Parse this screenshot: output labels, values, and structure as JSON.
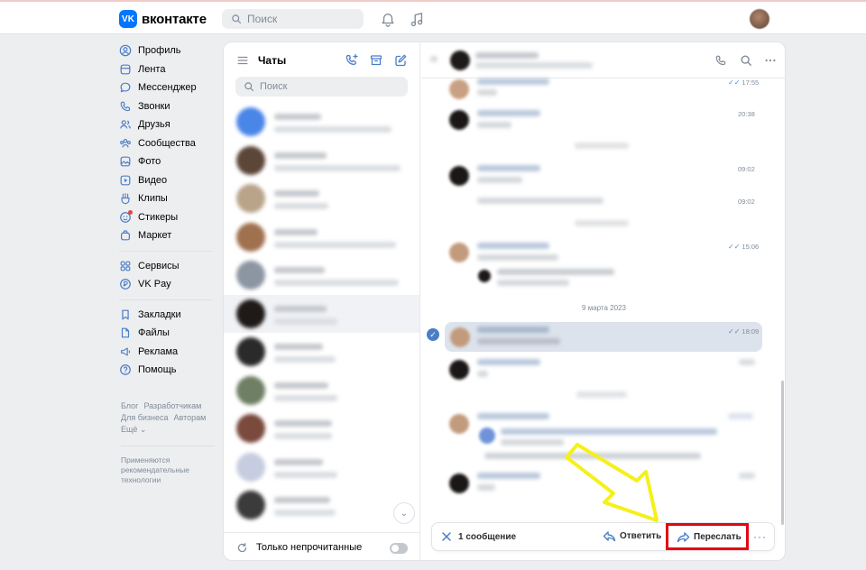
{
  "header": {
    "logo_mark": "VK",
    "logo_text": "вконтакте",
    "search_placeholder": "Поиск",
    "icons": [
      "bell-icon",
      "music-icon",
      "avatar"
    ]
  },
  "left_nav": {
    "group1": [
      {
        "label": "Профиль",
        "icon": "user-icon"
      },
      {
        "label": "Лента",
        "icon": "news-icon"
      },
      {
        "label": "Мессенджер",
        "icon": "message-icon"
      },
      {
        "label": "Звонки",
        "icon": "phone-icon"
      },
      {
        "label": "Друзья",
        "icon": "friends-icon"
      },
      {
        "label": "Сообщества",
        "icon": "groups-icon"
      },
      {
        "label": "Фото",
        "icon": "photo-icon"
      },
      {
        "label": "Видео",
        "icon": "video-icon"
      },
      {
        "label": "Клипы",
        "icon": "clips-icon"
      },
      {
        "label": "Стикеры",
        "icon": "sticker-icon"
      },
      {
        "label": "Маркет",
        "icon": "market-icon"
      }
    ],
    "group2": [
      {
        "label": "Сервисы",
        "icon": "services-icon"
      },
      {
        "label": "VK Pay",
        "icon": "pay-icon"
      }
    ],
    "group3": [
      {
        "label": "Закладки",
        "icon": "bookmark-icon"
      },
      {
        "label": "Файлы",
        "icon": "file-icon"
      },
      {
        "label": "Реклама",
        "icon": "ads-icon"
      },
      {
        "label": "Помощь",
        "icon": "help-icon"
      }
    ],
    "footer": {
      "blog": "Блог",
      "developers": "Разработчикам",
      "business": "Для бизнеса",
      "authors": "Авторам",
      "more": "Ещё ⌄",
      "note": "Применяются рекомендательные технологии"
    }
  },
  "chats": {
    "title": "Чаты",
    "search_placeholder": "Поиск",
    "unread_only_label": "Только непрочитанные",
    "scroll_down": "⌄"
  },
  "conversation": {
    "times": [
      "17:55",
      "20:38",
      "09:02",
      "09:02",
      "15:06",
      "18:09"
    ],
    "date_separator": "9 марта 2023"
  },
  "action_bar": {
    "count": "1 сообщение",
    "reply": "Ответить",
    "forward": "Переслать",
    "more": "···"
  },
  "colors": {
    "accent": "#0077ff",
    "highlight_box": "#e30613",
    "annotation_arrow": "#f5f01a",
    "selected_bubble": "#dde3ec"
  }
}
